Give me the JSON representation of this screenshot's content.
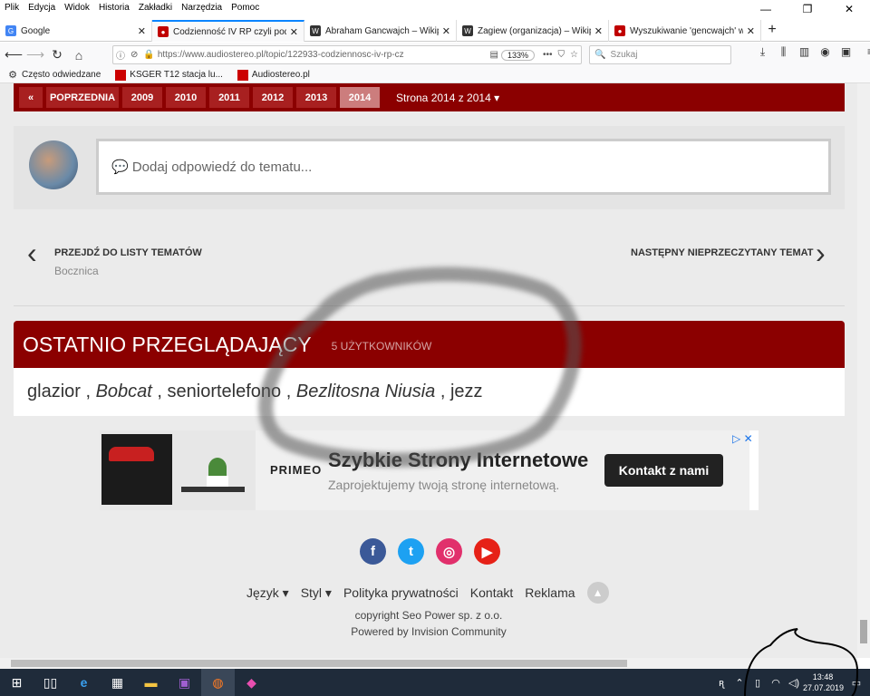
{
  "menubar": [
    "Plik",
    "Edycja",
    "Widok",
    "Historia",
    "Zakładki",
    "Narzędzia",
    "Pomoc"
  ],
  "tabs": [
    {
      "title": "Google",
      "icon": "google-icon",
      "color": "#4285f4",
      "active": false
    },
    {
      "title": "Codzienność IV RP czyli pod bu",
      "icon": "audiostereo-icon",
      "color": "#c00000",
      "active": true
    },
    {
      "title": "Abraham Gancwajch – Wikiped",
      "icon": "wikipedia-icon",
      "color": "#333333",
      "active": false
    },
    {
      "title": "Żagiew (organizacja) – Wikiped",
      "icon": "wikipedia-icon",
      "color": "#333333",
      "active": false
    },
    {
      "title": "Wyszukiwanie 'gencwajch' w W",
      "icon": "audiostereo-icon",
      "color": "#c00000",
      "active": false
    }
  ],
  "url": "https://www.audiostereo.pl/topic/122933-codziennosc-iv-rp-cz",
  "zoom": "133%",
  "search_placeholder": "Szukaj",
  "bookmarks": [
    {
      "label": "Często odwiedzane",
      "icon": "gear-icon"
    },
    {
      "label": "KSGER T12 stacja lu...",
      "icon": "store-icon"
    },
    {
      "label": "Audiostereo.pl",
      "icon": "audiostereo-icon"
    }
  ],
  "pager": {
    "prev_arrow": "«",
    "prev_label": "POPRZEDNIA",
    "pages": [
      "2009",
      "2010",
      "2011",
      "2012",
      "2013",
      "2014"
    ],
    "current": "2014",
    "page_text": "Strona 2014 z 2014 ▾"
  },
  "reply_placeholder": "💬 Dodaj odpowiedź do tematu...",
  "topic_nav": {
    "prev_label": "PRZEJDŹ DO LISTY TEMATÓW",
    "prev_sub": "Bocznica",
    "next_label": "NASTĘPNY NIEPRZECZYTANY TEMAT"
  },
  "recent": {
    "title": "OSTATNIO PRZEGLĄDAJĄCY",
    "count": "5 UŻYTKOWNIKÓW",
    "users": [
      {
        "name": "glazior",
        "italic": false
      },
      {
        "name": "Bobcat",
        "italic": true
      },
      {
        "name": "seniortelefono",
        "italic": false
      },
      {
        "name": "Bezlitosna Niusia",
        "italic": true
      },
      {
        "name": "jezz",
        "italic": false
      }
    ]
  },
  "ad": {
    "brand": "PRIMEO",
    "headline": "Szybkie Strony Internetowe",
    "sub": "Zaprojektujemy twoją stronę internetową.",
    "cta": "Kontakt z nami",
    "choices": "▷ ✕"
  },
  "social": [
    {
      "name": "facebook-icon",
      "glyph": "f",
      "color": "#3b5998"
    },
    {
      "name": "twitter-icon",
      "glyph": "t",
      "color": "#1da1f2"
    },
    {
      "name": "instagram-icon",
      "glyph": "◎",
      "color": "#e1306c"
    },
    {
      "name": "youtube-icon",
      "glyph": "▶",
      "color": "#e62117"
    }
  ],
  "footer": {
    "links": [
      "Język ▾",
      "Styl ▾",
      "Polityka prywatności",
      "Kontakt",
      "Reklama"
    ],
    "copyright": "copyright Seo Power sp. z o.o.",
    "powered": "Powered by Invision Community"
  },
  "taskbar": {
    "time": "13:48",
    "date": "27.07.2019"
  }
}
